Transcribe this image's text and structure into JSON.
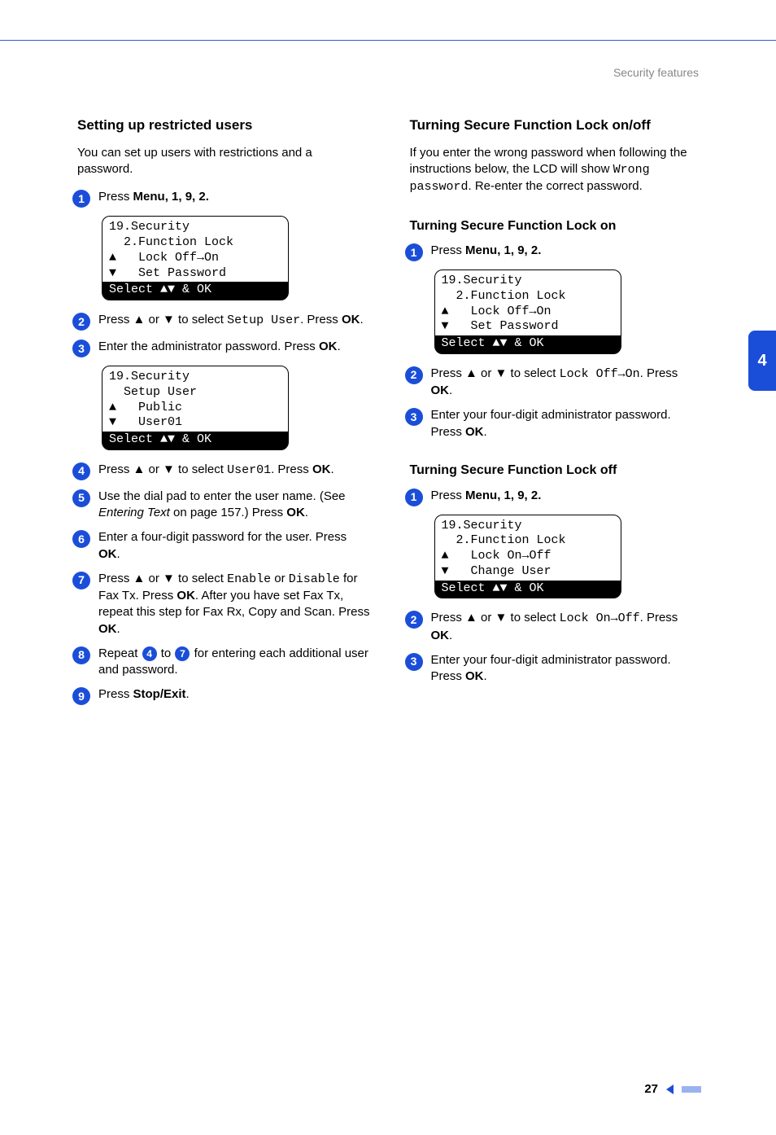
{
  "header": {
    "breadcrumb": "Security features"
  },
  "side_tab": "4",
  "footer": {
    "page_number": "27"
  },
  "left": {
    "heading": "Setting up restricted users",
    "intro": "You can set up users with restrictions and a password.",
    "steps": {
      "s1": {
        "pre": "Press ",
        "menu": "Menu",
        "keys": ", 1, 9, 2."
      },
      "s2": {
        "a": "Press ▲ or ▼ to select ",
        "mono": "Setup User",
        "b": ". Press ",
        "ok": "OK",
        "c": "."
      },
      "s3": {
        "a": "Enter the administrator password. Press ",
        "ok": "OK",
        "c": "."
      },
      "s4": {
        "a": "Press ▲ or ▼ to select ",
        "mono": "User01",
        "b": ". Press ",
        "ok": "OK",
        "c": "."
      },
      "s5": {
        "a": "Use the dial pad to enter the user name. (See ",
        "i": "Entering Text",
        "b": " on page 157.) Press ",
        "ok": "OK",
        "c": "."
      },
      "s6": {
        "a": "Enter a four-digit password for the user. Press ",
        "ok": "OK",
        "c": "."
      },
      "s7": {
        "a": "Press ▲ or ▼ to select ",
        "mono1": "Enable",
        "mid": " or ",
        "mono2": "Disable",
        "b": " for Fax Tx. Press ",
        "ok": "OK",
        "c": ". After you have set Fax Tx, repeat this step for Fax Rx, Copy and Scan. Press ",
        "ok2": "OK",
        "d": "."
      },
      "s8": {
        "a": "Repeat ",
        "b": " to ",
        "c": " for entering each additional user and password."
      },
      "s9": {
        "a": "Press ",
        "se": "Stop/Exit",
        "b": "."
      }
    },
    "lcd1": {
      "l1": "19.Security",
      "l2": "  2.Function Lock",
      "l3": "▲   Lock Off→On",
      "l4": "▼   Set Password",
      "l5": "Select ▲▼ & OK"
    },
    "lcd2": {
      "l1": "19.Security",
      "l2": "  Setup User",
      "l3": "▲   Public",
      "l4": "▼   User01",
      "l5": "Select ▲▼ & OK"
    }
  },
  "right": {
    "heading": "Turning Secure Function Lock on/off",
    "intro_a": "If you enter the wrong password when following the instructions below, the LCD will show ",
    "intro_mono": "Wrong password",
    "intro_b": ". Re-enter the correct password.",
    "sub_on": "Turning Secure Function Lock on",
    "sub_off": "Turning Secure Function Lock off",
    "on_steps": {
      "s1": {
        "pre": "Press ",
        "menu": "Menu",
        "keys": ", 1, 9, 2."
      },
      "s2": {
        "a": "Press ▲ or ▼ to select ",
        "mono": "Lock Off→On",
        "b": ". Press ",
        "ok": "OK",
        "c": "."
      },
      "s3": {
        "a": "Enter your four-digit administrator password. Press ",
        "ok": "OK",
        "c": "."
      }
    },
    "off_steps": {
      "s1": {
        "pre": "Press ",
        "menu": "Menu",
        "keys": ", 1, 9, 2."
      },
      "s2": {
        "a": "Press ▲ or ▼ to select ",
        "mono": "Lock On→Off",
        "b": ". Press ",
        "ok": "OK",
        "c": "."
      },
      "s3": {
        "a": "Enter your four-digit administrator password. Press ",
        "ok": "OK",
        "c": "."
      }
    },
    "lcd_on": {
      "l1": "19.Security",
      "l2": "  2.Function Lock",
      "l3": "▲   Lock Off→On",
      "l4": "▼   Set Password",
      "l5": "Select ▲▼ & OK"
    },
    "lcd_off": {
      "l1": "19.Security",
      "l2": "  2.Function Lock",
      "l3": "▲   Lock On→Off",
      "l4": "▼   Change User",
      "l5": "Select ▲▼ & OK"
    }
  }
}
